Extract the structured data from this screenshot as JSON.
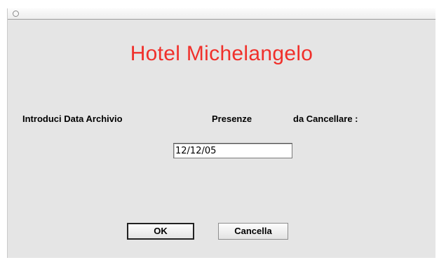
{
  "window": {
    "title": "Hotel Michelangelo"
  },
  "labels": {
    "introduci": "Introduci Data Archivio",
    "presenze": "Presenze",
    "da_cancellare": "da Cancellare :"
  },
  "date_field": {
    "value": "12/12/05"
  },
  "buttons": {
    "ok": "OK",
    "cancel": "Cancella"
  },
  "colors": {
    "title": "#f0302b",
    "background": "#e5e5e5"
  }
}
